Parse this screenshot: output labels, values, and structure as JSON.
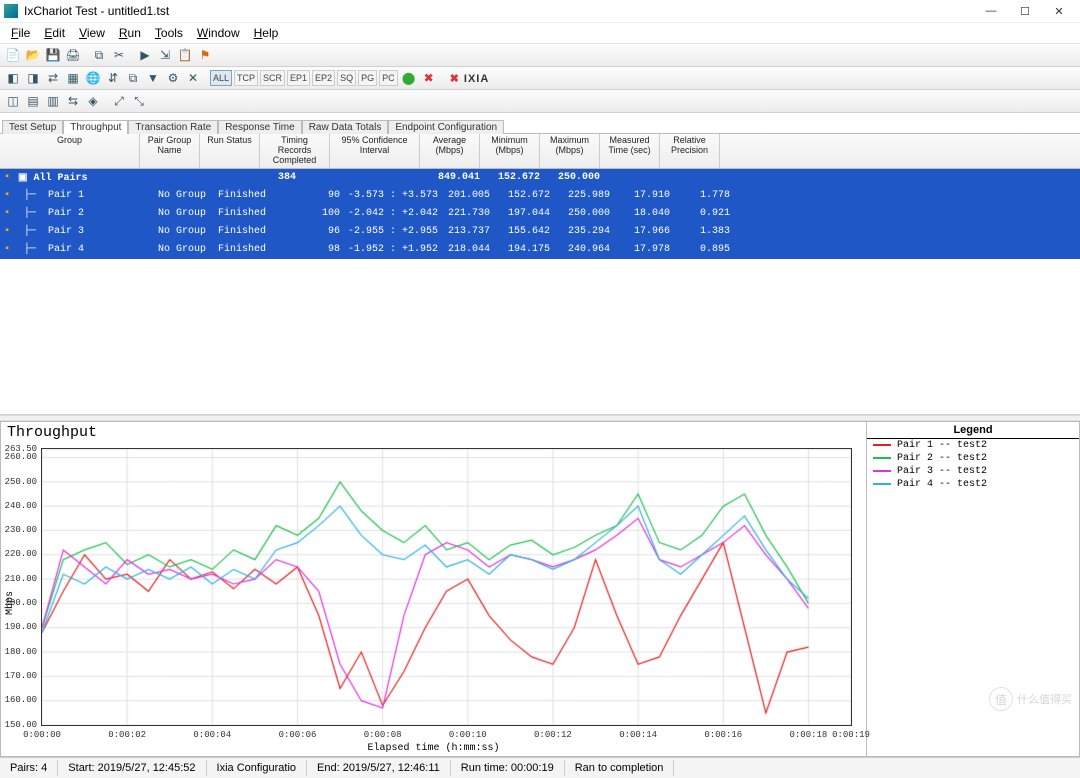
{
  "title": "IxChariot Test - untitled1.tst",
  "window_buttons": {
    "min": "—",
    "max": "☐",
    "close": "✕"
  },
  "menus": [
    "File",
    "Edit",
    "View",
    "Run",
    "Tools",
    "Window",
    "Help"
  ],
  "toolbar2_labels": [
    "ALL",
    "TCP",
    "SCR",
    "EP1",
    "EP2",
    "SQ",
    "PG",
    "PC"
  ],
  "brand": "IXIA",
  "tabs": [
    "Test Setup",
    "Throughput",
    "Transaction Rate",
    "Response Time",
    "Raw Data Totals",
    "Endpoint Configuration"
  ],
  "active_tab": 1,
  "columns": [
    {
      "label": "Group",
      "w": 140
    },
    {
      "label": "Pair Group\nName",
      "w": 60
    },
    {
      "label": "Run Status",
      "w": 60
    },
    {
      "label": "Timing Records\nCompleted",
      "w": 70
    },
    {
      "label": "95% Confidence\nInterval",
      "w": 90
    },
    {
      "label": "Average\n(Mbps)",
      "w": 60
    },
    {
      "label": "Minimum\n(Mbps)",
      "w": 60
    },
    {
      "label": "Maximum\n(Mbps)",
      "w": 60
    },
    {
      "label": "Measured\nTime (sec)",
      "w": 60
    },
    {
      "label": "Relative\nPrecision",
      "w": 60
    }
  ],
  "summary_row": {
    "label": "All Pairs",
    "records": "384",
    "avg": "849.041",
    "min": "152.672",
    "max": "250.000"
  },
  "rows": [
    {
      "name": "Pair 1",
      "grp": "No Group",
      "status": "Finished",
      "rec": "90",
      "ci": "-3.573 : +3.573",
      "avg": "201.005",
      "min": "152.672",
      "max": "225.989",
      "time": "17.910",
      "prec": "1.778"
    },
    {
      "name": "Pair 2",
      "grp": "No Group",
      "status": "Finished",
      "rec": "100",
      "ci": "-2.042 : +2.042",
      "avg": "221.730",
      "min": "197.044",
      "max": "250.000",
      "time": "18.040",
      "prec": "0.921"
    },
    {
      "name": "Pair 3",
      "grp": "No Group",
      "status": "Finished",
      "rec": "96",
      "ci": "-2.955 : +2.955",
      "avg": "213.737",
      "min": "155.642",
      "max": "235.294",
      "time": "17.966",
      "prec": "1.383"
    },
    {
      "name": "Pair 4",
      "grp": "No Group",
      "status": "Finished",
      "rec": "98",
      "ci": "-1.952 : +1.952",
      "avg": "218.044",
      "min": "194.175",
      "max": "240.964",
      "time": "17.978",
      "prec": "0.895"
    }
  ],
  "legend_title": "Legend",
  "legend": [
    {
      "label": "Pair 1 -- test2",
      "color": "#e02020"
    },
    {
      "label": "Pair 2 -- test2",
      "color": "#20c050"
    },
    {
      "label": "Pair 3 -- test2",
      "color": "#e030e0"
    },
    {
      "label": "Pair 4 -- test2",
      "color": "#30b0e0"
    }
  ],
  "status": [
    {
      "k": "Pairs",
      "v": "4"
    },
    {
      "k": "Start",
      "v": "2019/5/27, 12:45:52"
    },
    {
      "k": "Ixia Configuratio",
      "v": ""
    },
    {
      "k": "End",
      "v": "2019/5/27, 12:46:11"
    },
    {
      "k": "Run time",
      "v": "00:00:19"
    },
    {
      "k": "Ran to completion",
      "v": ""
    }
  ],
  "watermark": "什么值得买",
  "chart_data": {
    "type": "line",
    "title": "Throughput",
    "xlabel": "Elapsed time (h:mm:ss)",
    "ylabel": "Mbps",
    "ylim": [
      150,
      263.5
    ],
    "yticks": [
      150,
      160,
      170,
      180,
      190,
      200,
      210,
      220,
      230,
      240,
      250,
      260,
      263.5
    ],
    "xlim": [
      0,
      19
    ],
    "xticks": [
      0,
      2,
      4,
      6,
      8,
      10,
      12,
      14,
      16,
      18,
      19
    ],
    "xticklabels": [
      "0:00:00",
      "0:00:02",
      "0:00:04",
      "0:00:06",
      "0:00:08",
      "0:00:10",
      "0:00:12",
      "0:00:14",
      "0:00:16",
      "0:00:18",
      "0:00:19"
    ],
    "series": [
      {
        "name": "Pair 1",
        "color": "#e02020",
        "x": [
          0,
          0.5,
          1,
          1.5,
          2,
          2.5,
          3,
          3.5,
          4,
          4.5,
          5,
          5.5,
          6,
          6.5,
          7,
          7.5,
          8,
          8.5,
          9,
          9.5,
          10,
          10.5,
          11,
          11.5,
          12,
          12.5,
          13,
          13.5,
          14,
          14.5,
          15,
          15.5,
          16,
          16.5,
          17,
          17.5,
          18
        ],
        "y": [
          188,
          205,
          220,
          210,
          212,
          205,
          218,
          210,
          213,
          206,
          214,
          208,
          215,
          195,
          165,
          180,
          158,
          172,
          190,
          205,
          210,
          195,
          185,
          178,
          175,
          190,
          218,
          195,
          175,
          178,
          195,
          210,
          225,
          190,
          155,
          180,
          182
        ]
      },
      {
        "name": "Pair 2",
        "color": "#20c050",
        "x": [
          0,
          0.5,
          1,
          1.5,
          2,
          2.5,
          3,
          3.5,
          4,
          4.5,
          5,
          5.5,
          6,
          6.5,
          7,
          7.5,
          8,
          8.5,
          9,
          9.5,
          10,
          10.5,
          11,
          11.5,
          12,
          12.5,
          13,
          13.5,
          14,
          14.5,
          15,
          15.5,
          16,
          16.5,
          17,
          17.5,
          18
        ],
        "y": [
          190,
          218,
          222,
          225,
          216,
          220,
          215,
          218,
          214,
          222,
          218,
          232,
          228,
          235,
          250,
          238,
          230,
          225,
          232,
          222,
          225,
          218,
          224,
          226,
          220,
          223,
          228,
          232,
          245,
          225,
          222,
          228,
          240,
          245,
          228,
          215,
          200
        ]
      },
      {
        "name": "Pair 3",
        "color": "#e030e0",
        "x": [
          0,
          0.5,
          1,
          1.5,
          2,
          2.5,
          3,
          3.5,
          4,
          4.5,
          5,
          5.5,
          6,
          6.5,
          7,
          7.5,
          8,
          8.5,
          9,
          9.5,
          10,
          10.5,
          11,
          11.5,
          12,
          12.5,
          13,
          13.5,
          14,
          14.5,
          15,
          15.5,
          16,
          16.5,
          17,
          17.5,
          18
        ],
        "y": [
          190,
          222,
          215,
          208,
          218,
          212,
          214,
          210,
          212,
          208,
          210,
          218,
          215,
          205,
          175,
          160,
          157,
          195,
          220,
          225,
          222,
          215,
          220,
          218,
          215,
          218,
          222,
          228,
          235,
          218,
          215,
          220,
          225,
          232,
          220,
          210,
          198
        ]
      },
      {
        "name": "Pair 4",
        "color": "#30b0e0",
        "x": [
          0,
          0.5,
          1,
          1.5,
          2,
          2.5,
          3,
          3.5,
          4,
          4.5,
          5,
          5.5,
          6,
          6.5,
          7,
          7.5,
          8,
          8.5,
          9,
          9.5,
          10,
          10.5,
          11,
          11.5,
          12,
          12.5,
          13,
          13.5,
          14,
          14.5,
          15,
          15.5,
          16,
          16.5,
          17,
          17.5,
          18
        ],
        "y": [
          188,
          212,
          208,
          215,
          210,
          214,
          210,
          215,
          208,
          214,
          210,
          222,
          225,
          232,
          240,
          228,
          220,
          218,
          224,
          215,
          218,
          212,
          220,
          218,
          214,
          218,
          225,
          232,
          240,
          218,
          212,
          220,
          228,
          236,
          222,
          210,
          202
        ]
      }
    ]
  }
}
